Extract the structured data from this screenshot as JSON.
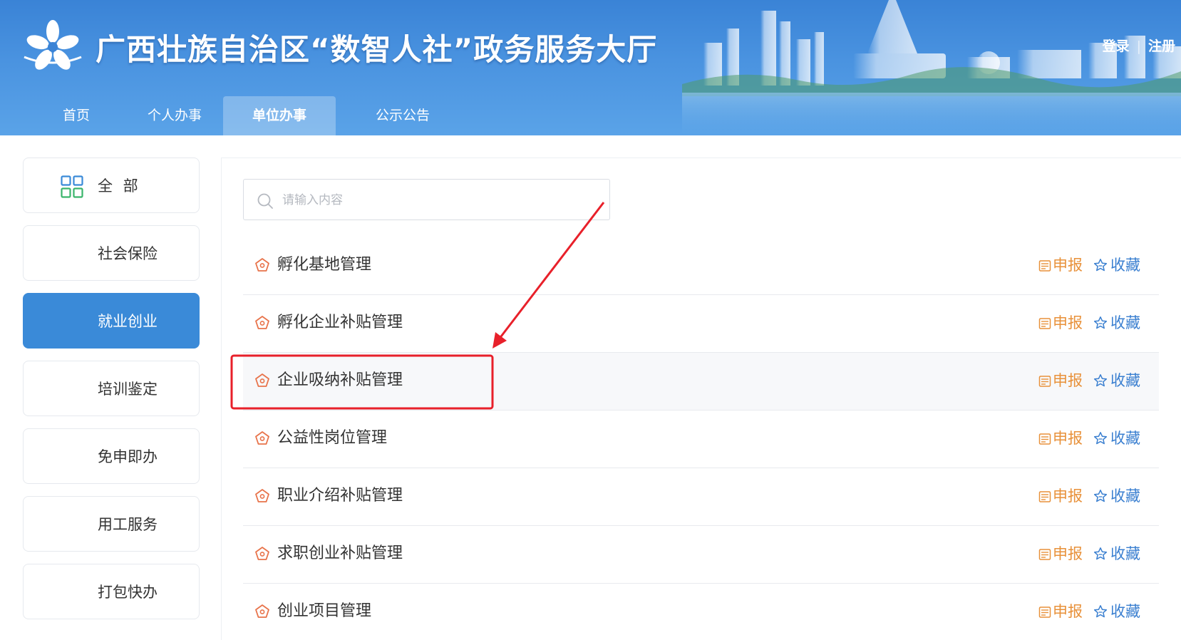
{
  "header": {
    "title": "广西壮族自治区“数智人社”政务服务大厅",
    "login": "登录",
    "separator": "|",
    "register": "注册",
    "nav": [
      {
        "label": "首页",
        "active": false
      },
      {
        "label": "个人办事",
        "active": false
      },
      {
        "label": "单位办事",
        "active": true
      },
      {
        "label": "公示公告",
        "active": false
      }
    ]
  },
  "sidebar": {
    "items": [
      {
        "label": "全 部",
        "icon": "grid-icon",
        "active": false
      },
      {
        "label": "社会保险",
        "active": false
      },
      {
        "label": "就业创业",
        "active": true
      },
      {
        "label": "培训鉴定",
        "active": false
      },
      {
        "label": "免申即办",
        "active": false
      },
      {
        "label": "用工服务",
        "active": false
      },
      {
        "label": "打包快办",
        "active": false
      }
    ]
  },
  "search": {
    "placeholder": "请输入内容",
    "value": ""
  },
  "services": [
    {
      "label": "孵化基地管理",
      "apply": "申报",
      "favorite": "收藏",
      "highlighted": false
    },
    {
      "label": "孵化企业补贴管理",
      "apply": "申报",
      "favorite": "收藏",
      "highlighted": false
    },
    {
      "label": "企业吸纳补贴管理",
      "apply": "申报",
      "favorite": "收藏",
      "highlighted": true
    },
    {
      "label": "公益性岗位管理",
      "apply": "申报",
      "favorite": "收藏",
      "highlighted": false
    },
    {
      "label": "职业介绍补贴管理",
      "apply": "申报",
      "favorite": "收藏",
      "highlighted": false
    },
    {
      "label": "求职创业补贴管理",
      "apply": "申报",
      "favorite": "收藏",
      "highlighted": false
    },
    {
      "label": "创业项目管理",
      "apply": "申报",
      "favorite": "收藏",
      "highlighted": false
    }
  ],
  "colors": {
    "header_blue": "#3a83d6",
    "active_blue": "#3a8ad8",
    "apply_orange": "#e8913a",
    "favorite_blue": "#3a7fd0",
    "annotation_red": "#e8202a"
  }
}
